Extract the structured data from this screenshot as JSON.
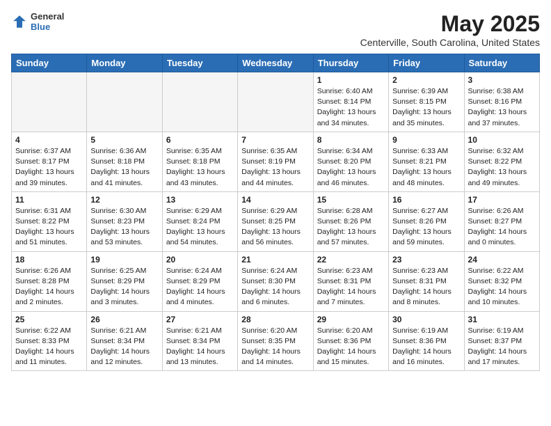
{
  "header": {
    "logo": {
      "general": "General",
      "blue": "Blue"
    },
    "title": "May 2025",
    "location": "Centerville, South Carolina, United States"
  },
  "days_of_week": [
    "Sunday",
    "Monday",
    "Tuesday",
    "Wednesday",
    "Thursday",
    "Friday",
    "Saturday"
  ],
  "weeks": [
    [
      {
        "day": "",
        "info": ""
      },
      {
        "day": "",
        "info": ""
      },
      {
        "day": "",
        "info": ""
      },
      {
        "day": "",
        "info": ""
      },
      {
        "day": "1",
        "info": "Sunrise: 6:40 AM\nSunset: 8:14 PM\nDaylight: 13 hours\nand 34 minutes."
      },
      {
        "day": "2",
        "info": "Sunrise: 6:39 AM\nSunset: 8:15 PM\nDaylight: 13 hours\nand 35 minutes."
      },
      {
        "day": "3",
        "info": "Sunrise: 6:38 AM\nSunset: 8:16 PM\nDaylight: 13 hours\nand 37 minutes."
      }
    ],
    [
      {
        "day": "4",
        "info": "Sunrise: 6:37 AM\nSunset: 8:17 PM\nDaylight: 13 hours\nand 39 minutes."
      },
      {
        "day": "5",
        "info": "Sunrise: 6:36 AM\nSunset: 8:18 PM\nDaylight: 13 hours\nand 41 minutes."
      },
      {
        "day": "6",
        "info": "Sunrise: 6:35 AM\nSunset: 8:18 PM\nDaylight: 13 hours\nand 43 minutes."
      },
      {
        "day": "7",
        "info": "Sunrise: 6:35 AM\nSunset: 8:19 PM\nDaylight: 13 hours\nand 44 minutes."
      },
      {
        "day": "8",
        "info": "Sunrise: 6:34 AM\nSunset: 8:20 PM\nDaylight: 13 hours\nand 46 minutes."
      },
      {
        "day": "9",
        "info": "Sunrise: 6:33 AM\nSunset: 8:21 PM\nDaylight: 13 hours\nand 48 minutes."
      },
      {
        "day": "10",
        "info": "Sunrise: 6:32 AM\nSunset: 8:22 PM\nDaylight: 13 hours\nand 49 minutes."
      }
    ],
    [
      {
        "day": "11",
        "info": "Sunrise: 6:31 AM\nSunset: 8:22 PM\nDaylight: 13 hours\nand 51 minutes."
      },
      {
        "day": "12",
        "info": "Sunrise: 6:30 AM\nSunset: 8:23 PM\nDaylight: 13 hours\nand 53 minutes."
      },
      {
        "day": "13",
        "info": "Sunrise: 6:29 AM\nSunset: 8:24 PM\nDaylight: 13 hours\nand 54 minutes."
      },
      {
        "day": "14",
        "info": "Sunrise: 6:29 AM\nSunset: 8:25 PM\nDaylight: 13 hours\nand 56 minutes."
      },
      {
        "day": "15",
        "info": "Sunrise: 6:28 AM\nSunset: 8:26 PM\nDaylight: 13 hours\nand 57 minutes."
      },
      {
        "day": "16",
        "info": "Sunrise: 6:27 AM\nSunset: 8:26 PM\nDaylight: 13 hours\nand 59 minutes."
      },
      {
        "day": "17",
        "info": "Sunrise: 6:26 AM\nSunset: 8:27 PM\nDaylight: 14 hours\nand 0 minutes."
      }
    ],
    [
      {
        "day": "18",
        "info": "Sunrise: 6:26 AM\nSunset: 8:28 PM\nDaylight: 14 hours\nand 2 minutes."
      },
      {
        "day": "19",
        "info": "Sunrise: 6:25 AM\nSunset: 8:29 PM\nDaylight: 14 hours\nand 3 minutes."
      },
      {
        "day": "20",
        "info": "Sunrise: 6:24 AM\nSunset: 8:29 PM\nDaylight: 14 hours\nand 4 minutes."
      },
      {
        "day": "21",
        "info": "Sunrise: 6:24 AM\nSunset: 8:30 PM\nDaylight: 14 hours\nand 6 minutes."
      },
      {
        "day": "22",
        "info": "Sunrise: 6:23 AM\nSunset: 8:31 PM\nDaylight: 14 hours\nand 7 minutes."
      },
      {
        "day": "23",
        "info": "Sunrise: 6:23 AM\nSunset: 8:31 PM\nDaylight: 14 hours\nand 8 minutes."
      },
      {
        "day": "24",
        "info": "Sunrise: 6:22 AM\nSunset: 8:32 PM\nDaylight: 14 hours\nand 10 minutes."
      }
    ],
    [
      {
        "day": "25",
        "info": "Sunrise: 6:22 AM\nSunset: 8:33 PM\nDaylight: 14 hours\nand 11 minutes."
      },
      {
        "day": "26",
        "info": "Sunrise: 6:21 AM\nSunset: 8:34 PM\nDaylight: 14 hours\nand 12 minutes."
      },
      {
        "day": "27",
        "info": "Sunrise: 6:21 AM\nSunset: 8:34 PM\nDaylight: 14 hours\nand 13 minutes."
      },
      {
        "day": "28",
        "info": "Sunrise: 6:20 AM\nSunset: 8:35 PM\nDaylight: 14 hours\nand 14 minutes."
      },
      {
        "day": "29",
        "info": "Sunrise: 6:20 AM\nSunset: 8:36 PM\nDaylight: 14 hours\nand 15 minutes."
      },
      {
        "day": "30",
        "info": "Sunrise: 6:19 AM\nSunset: 8:36 PM\nDaylight: 14 hours\nand 16 minutes."
      },
      {
        "day": "31",
        "info": "Sunrise: 6:19 AM\nSunset: 8:37 PM\nDaylight: 14 hours\nand 17 minutes."
      }
    ]
  ]
}
